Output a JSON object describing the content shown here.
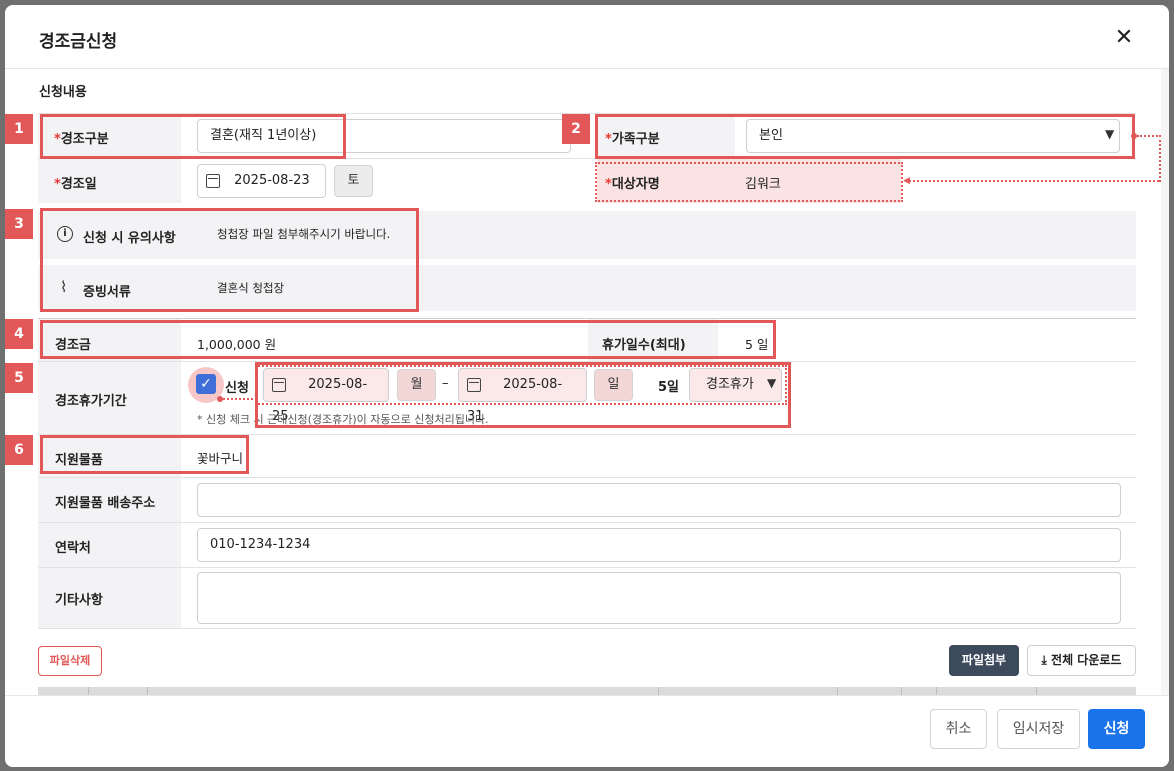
{
  "modal": {
    "title": "경조금신청",
    "close_symbol": "✕"
  },
  "section": {
    "title": "신청내용"
  },
  "fields": {
    "event_type": {
      "label": "경조구분",
      "required_mark": "*",
      "value": "결혼(재직 1년이상)"
    },
    "family_type": {
      "label": "가족구분",
      "required_mark": "*",
      "value": "본인"
    },
    "event_date": {
      "label": "경조일",
      "required_mark": "*",
      "value": "2025-08-23",
      "weekday": "토"
    },
    "target_name": {
      "label": "대상자명",
      "required_mark": "*",
      "value": "김워크"
    },
    "notice": {
      "label": "신청 시 유의사항",
      "value": "청첩장 파일 첨부해주시기 바랍니다."
    },
    "evidence": {
      "label": "증빙서류",
      "value": "결혼식 청첩장"
    },
    "amount": {
      "label": "경조금",
      "value": "1,000,000 원"
    },
    "max_days": {
      "label": "휴가일수(최대)",
      "value": "5 일"
    },
    "leave_period": {
      "label": "경조휴가기간",
      "checkbox_label": "신청",
      "checked": true,
      "start_date": "2025-08-25",
      "start_weekday": "월",
      "separator": "–",
      "end_date": "2025-08-31",
      "end_weekday": "일",
      "days": "5일",
      "leave_type": "경조휴가",
      "note": "* 신청 체크 시 근태신청(경조휴가)이 자동으로 신청처리됩니다."
    },
    "gift": {
      "label": "지원물품",
      "value": "꽃바구니"
    },
    "gift_address": {
      "label": "지원물품 배송주소",
      "value": ""
    },
    "contact": {
      "label": "연락처",
      "value": "010-1234-1234"
    },
    "etc": {
      "label": "기타사항",
      "value": ""
    }
  },
  "badges": [
    "1",
    "2",
    "3",
    "4",
    "5",
    "6"
  ],
  "file": {
    "delete_label": "파일삭제",
    "attach_label": "파일첨부",
    "download_all_label": "전체 다운로드"
  },
  "footer": {
    "cancel_label": "취소",
    "temp_save_label": "임시저장",
    "submit_label": "신청"
  },
  "colors": {
    "accent": "#1a73e8",
    "highlight": "#e25858",
    "dark_button": "#3d4a5c"
  },
  "icons": [
    "close-icon",
    "calendar-icon",
    "info-icon",
    "paperclip-icon",
    "check-icon",
    "chevron-down-icon",
    "download-icon"
  ]
}
